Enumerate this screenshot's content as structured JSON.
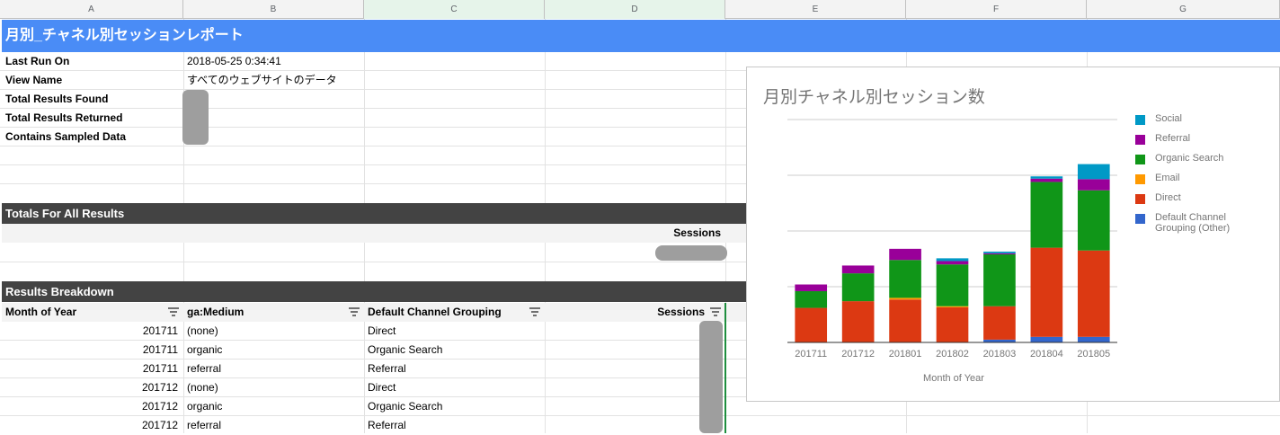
{
  "columns": [
    "A",
    "B",
    "C",
    "D",
    "E",
    "F",
    "G"
  ],
  "title": "月別_チャネル別セッションレポート",
  "meta": {
    "last_run_label": "Last Run On",
    "last_run_value": "2018-05-25 0:34:41",
    "view_name_label": "View Name",
    "view_name_value": "すべてのウェブサイトのデータ",
    "total_found_label": "Total Results Found",
    "total_returned_label": "Total Results Returned",
    "sampled_label": "Contains Sampled Data"
  },
  "totals": {
    "header": "Totals For All Results",
    "sessions_label": "Sessions"
  },
  "breakdown": {
    "header": "Results Breakdown",
    "columns": [
      "Month of Year",
      "ga:Medium",
      "Default Channel Grouping",
      "Sessions"
    ],
    "rows": [
      {
        "month": "201711",
        "medium": "(none)",
        "channel": "Direct"
      },
      {
        "month": "201711",
        "medium": "organic",
        "channel": "Organic Search"
      },
      {
        "month": "201711",
        "medium": "referral",
        "channel": "Referral"
      },
      {
        "month": "201712",
        "medium": "(none)",
        "channel": "Direct"
      },
      {
        "month": "201712",
        "medium": "organic",
        "channel": "Organic Search"
      },
      {
        "month": "201712",
        "medium": "referral",
        "channel": "Referral"
      }
    ]
  },
  "colors": {
    "title_bar": "#4a8cf6",
    "dark_bar": "#434343",
    "selected_col": "#e6f4ea"
  },
  "chart_data": {
    "type": "bar",
    "stacked": true,
    "title": "月別チャネル別セッション数",
    "xlabel": "Month of Year",
    "ylabel": "",
    "categories": [
      "201711",
      "201712",
      "201801",
      "201802",
      "201803",
      "201804",
      "201805"
    ],
    "ylim": [
      0,
      4
    ],
    "grid": true,
    "legend_position": "right",
    "series": [
      {
        "name": "Default Channel Grouping (Other)",
        "color": "#3366cc",
        "values": [
          0,
          0,
          0,
          0,
          0.05,
          0.1,
          0.1
        ]
      },
      {
        "name": "Direct",
        "color": "#dc3912",
        "values": [
          0.62,
          0.74,
          0.77,
          0.63,
          0.6,
          1.6,
          1.55
        ]
      },
      {
        "name": "Email",
        "color": "#ff9900",
        "values": [
          0,
          0,
          0.03,
          0.02,
          0,
          0,
          0
        ]
      },
      {
        "name": "Organic Search",
        "color": "#109618",
        "values": [
          0.3,
          0.5,
          0.68,
          0.75,
          0.93,
          1.18,
          1.08
        ]
      },
      {
        "name": "Referral",
        "color": "#990099",
        "values": [
          0.12,
          0.14,
          0.2,
          0.06,
          0.02,
          0.06,
          0.2
        ]
      },
      {
        "name": "Social",
        "color": "#0099c6",
        "values": [
          0,
          0,
          0,
          0.05,
          0.03,
          0.04,
          0.27
        ]
      }
    ],
    "legend_order": [
      "Social",
      "Referral",
      "Organic Search",
      "Email",
      "Direct",
      "Default Channel Grouping (Other)"
    ]
  }
}
